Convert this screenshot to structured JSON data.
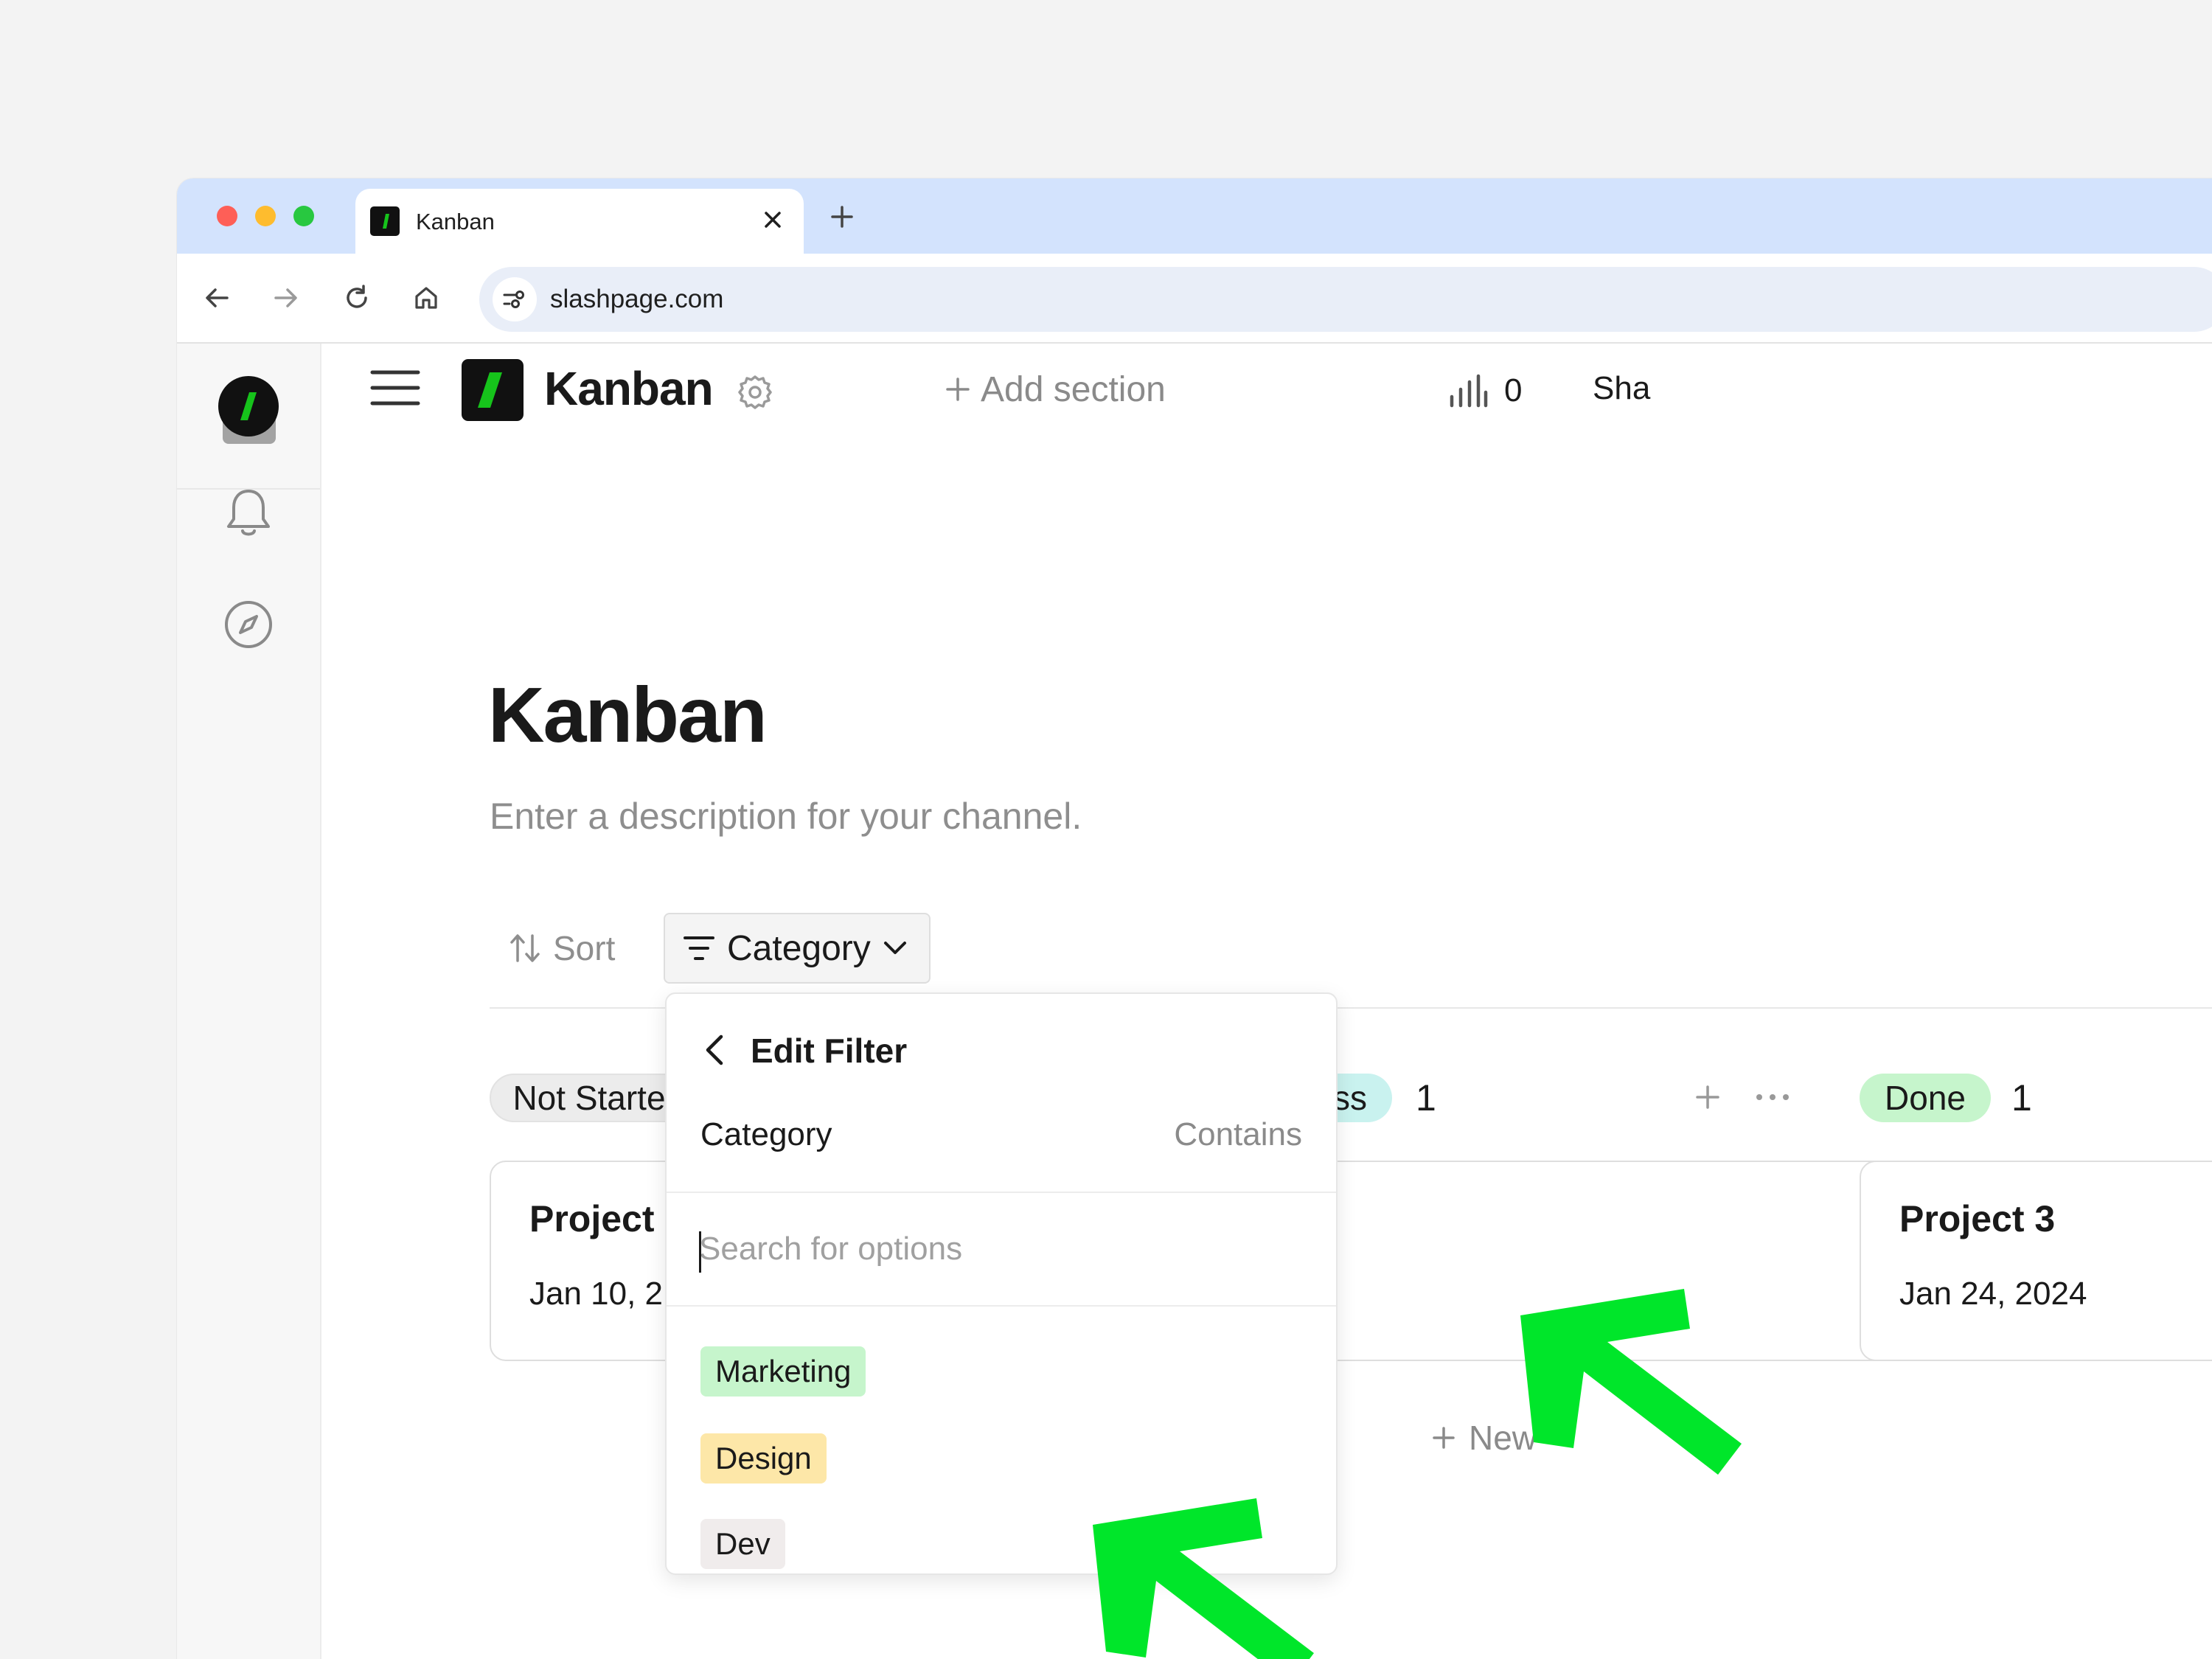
{
  "browser": {
    "tab_title": "Kanban",
    "url": "slashpage.com",
    "icons": {
      "back": "arrow-left-icon",
      "forward": "arrow-right-icon",
      "reload": "reload-icon",
      "home": "home-icon",
      "site_info": "tune-icon",
      "close_tab": "close-icon",
      "new_tab": "plus-icon"
    }
  },
  "rail": {
    "items": [
      {
        "name": "slashpage-logo-icon"
      },
      {
        "name": "workspace-avatar-icon"
      },
      {
        "name": "bell-icon"
      },
      {
        "name": "compass-icon"
      }
    ]
  },
  "header": {
    "channel_name": "Kanban",
    "add_section_label": "Add section",
    "stats_count": "0",
    "share_label": "Sha"
  },
  "page": {
    "title": "Kanban",
    "description_placeholder": "Enter a description for your channel."
  },
  "toolbar": {
    "sort_label": "Sort",
    "filter_label": "Category"
  },
  "board": {
    "columns": [
      {
        "status": "Not Started",
        "visible_label": "Not Starte",
        "color": "#ececec"
      },
      {
        "status": "In Progress",
        "visible_label": "ess",
        "count": "1",
        "color": "#c9f2ef"
      },
      {
        "status": "Done",
        "visible_label": "Done",
        "count": "1",
        "color": "#c6f5cc"
      }
    ],
    "cards": [
      {
        "title": "Project",
        "date": "Jan 10, 2"
      },
      {
        "title": "Project 3",
        "date": "Jan 24, 2024"
      }
    ],
    "new_label": "New"
  },
  "filter_dropdown": {
    "title": "Edit Filter",
    "property": "Category",
    "operator": "Contains",
    "search_placeholder": "Search for options",
    "search_value": "",
    "options": [
      {
        "label": "Marketing",
        "color": "#c6f5cc"
      },
      {
        "label": "Design",
        "color": "#fde7a8"
      },
      {
        "label": "Dev",
        "color": "#f0ecec"
      }
    ]
  },
  "colors": {
    "brand": "#16c31b",
    "brand_dark": "#111111",
    "annotation_arrow": "#00e62a",
    "tab_strip": "#d3e3fd"
  }
}
